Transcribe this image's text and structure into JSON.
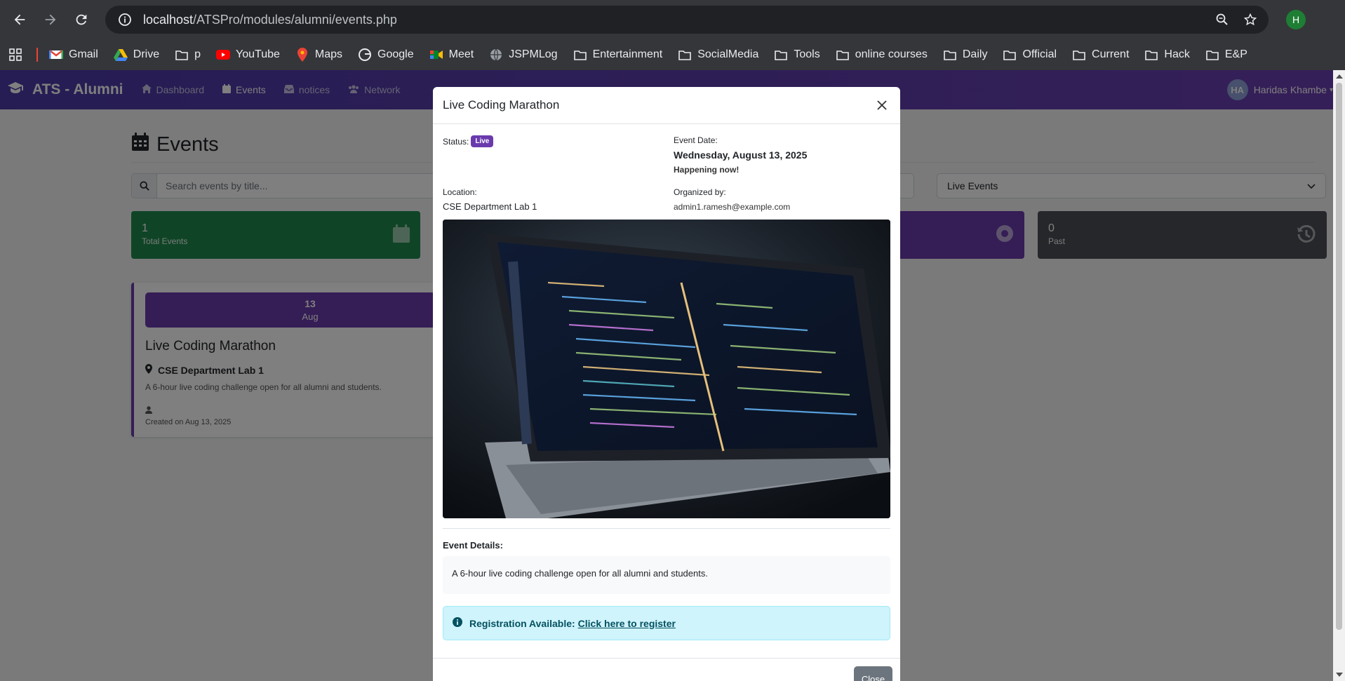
{
  "browser": {
    "url_host": "localhost",
    "url_path": "/ATSPro/modules/alumni/events.php",
    "profile_initial": "H",
    "bookmarks": [
      {
        "label": "Gmail",
        "icon": "gmail-icon"
      },
      {
        "label": "Drive",
        "icon": "drive-icon"
      },
      {
        "label": "p",
        "icon": "folder-icon"
      },
      {
        "label": "YouTube",
        "icon": "youtube-icon"
      },
      {
        "label": "Maps",
        "icon": "maps-icon"
      },
      {
        "label": "Google",
        "icon": "google-icon"
      },
      {
        "label": "Meet",
        "icon": "meet-icon"
      },
      {
        "label": "JSPMLog",
        "icon": "globe-icon"
      },
      {
        "label": "Entertainment",
        "icon": "folder-icon"
      },
      {
        "label": "SocialMedia",
        "icon": "folder-icon"
      },
      {
        "label": "Tools",
        "icon": "folder-icon"
      },
      {
        "label": "online courses",
        "icon": "folder-icon"
      },
      {
        "label": "Daily",
        "icon": "folder-icon"
      },
      {
        "label": "Official",
        "icon": "folder-icon"
      },
      {
        "label": "Current",
        "icon": "folder-icon"
      },
      {
        "label": "Hack",
        "icon": "folder-icon"
      },
      {
        "label": "E&P",
        "icon": "folder-icon"
      }
    ]
  },
  "app": {
    "brand": "ATS - Alumni",
    "nav": [
      {
        "label": "Dashboard",
        "icon": "home-icon",
        "active": false
      },
      {
        "label": "Events",
        "icon": "calendar-icon",
        "active": true
      },
      {
        "label": "notices",
        "icon": "inbox-icon",
        "active": false
      },
      {
        "label": "Network",
        "icon": "users-icon",
        "active": false
      }
    ],
    "user": {
      "initials": "HA",
      "name": "Haridas Khambe"
    },
    "colors": {
      "primary": "#6a3aad",
      "success": "#1f8a4c",
      "info_bg": "#cff4fc"
    }
  },
  "page": {
    "title": "Events",
    "search_placeholder": "Search events by title...",
    "filter_value": "Live Events",
    "stats": {
      "total": {
        "value": "1",
        "label": "Total Events"
      },
      "past": {
        "value": "0",
        "label": "Past"
      }
    },
    "event_card": {
      "day": "13",
      "month": "Aug",
      "title": "Live Coding Marathon",
      "location": "CSE Department Lab 1",
      "description": "A 6-hour live coding challenge open for all alumni and students.",
      "created": "Created on Aug 13, 2025"
    }
  },
  "modal": {
    "title": "Live Coding Marathon",
    "status_label": "Status:",
    "status_badge": "Live",
    "date_label": "Event Date:",
    "date_value": "Wednesday, August 13, 2025",
    "date_sub": "Happening now!",
    "location_label": "Location:",
    "location_value": "CSE Department Lab 1",
    "organizer_label": "Organized by:",
    "organizer_value": "admin1.ramesh@example.com",
    "details_label": "Event Details:",
    "details_text": "A 6-hour live coding challenge open for all alumni and students.",
    "registration_prefix": "Registration Available:",
    "registration_link": "Click here to register",
    "close_button": "Close"
  }
}
